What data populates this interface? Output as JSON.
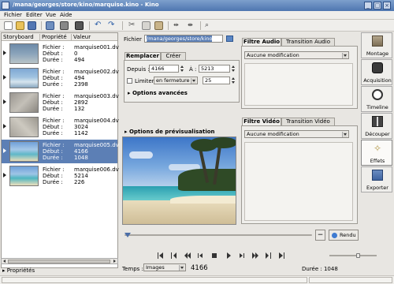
{
  "window": {
    "title": "/mana/georges/store/kino/marquise.kino - Kino"
  },
  "menu": [
    "Fichier",
    "Editer",
    "Vue",
    "Aide"
  ],
  "toolbar": {
    "icons": [
      "new-file-icon",
      "open-icon",
      "save-icon",
      "capture-icon",
      "split-icon",
      "undo-icon",
      "redo-icon",
      "cut-icon",
      "copy-icon",
      "paste-icon",
      "split-scene-icon",
      "join-icon",
      "zoom-icon"
    ]
  },
  "storyboard": {
    "columns": [
      "Storyboard",
      "Propriété",
      "Valeur"
    ],
    "field_labels": [
      "Fichier :",
      "Début :",
      "Durée :"
    ],
    "clips": [
      {
        "file": "marquise001.dv",
        "start": "0",
        "duration": "494",
        "selected": false
      },
      {
        "file": "marquise002.dv",
        "start": "494",
        "duration": "2398",
        "selected": false
      },
      {
        "file": "marquise003.dv",
        "start": "2892",
        "duration": "132",
        "selected": false
      },
      {
        "file": "marquise004.dv",
        "start": "3024",
        "duration": "1142",
        "selected": false
      },
      {
        "file": "marquise005.dv",
        "start": "4166",
        "duration": "1048",
        "selected": true
      },
      {
        "file": "marquise006.dv",
        "start": "5214",
        "duration": "226",
        "selected": false
      }
    ],
    "properties_label": "Propriétés"
  },
  "export_panel": {
    "file_label": "Fichier :",
    "file_value": "/mana/georges/store/kino",
    "tabs": [
      "Remplacer",
      "Créer"
    ],
    "from_label": "Depuis :",
    "from_value": "4166",
    "to_label": "À :",
    "to_value": "5213",
    "limit_label": "Limiter",
    "limit_combo": "en fermeture à",
    "limit_value": "25",
    "advanced_label": "Options avancées",
    "preview_label": "Options de prévisualisation"
  },
  "audio_panel": {
    "tabs": [
      "Filtre Audio",
      "Transition Audio"
    ],
    "combo": "Aucune modification"
  },
  "video_panel": {
    "tabs": [
      "Filtre Vidéo",
      "Transition Vidéo"
    ],
    "combo": "Aucune modification"
  },
  "sidebar": [
    {
      "label": "Montage",
      "icon": "montage-icon",
      "active": false
    },
    {
      "label": "Acquisition",
      "icon": "camera-icon",
      "active": false
    },
    {
      "label": "Timeline",
      "icon": "clock-icon",
      "active": false
    },
    {
      "label": "Découper",
      "icon": "trim-icon",
      "active": false
    },
    {
      "label": "Effets",
      "icon": "sparkle-icon",
      "active": true
    },
    {
      "label": "Exporter",
      "icon": "export-icon",
      "active": false
    }
  ],
  "render": {
    "minus_label": "−",
    "button_label": "Rendu"
  },
  "transport_icons": [
    "start-icon",
    "prev-scene-icon",
    "rewind-icon",
    "step-back-icon",
    "stop-icon",
    "play-icon",
    "step-forward-icon",
    "forward-icon",
    "next-scene-icon",
    "end-icon"
  ],
  "status": {
    "time_label": "Temps :",
    "time_format": "Images",
    "frame_value": "4166",
    "duration_text": "Durée : 1048"
  },
  "colors": {
    "selection": "#5c7fb5",
    "titlebar": "#4e76b0"
  }
}
